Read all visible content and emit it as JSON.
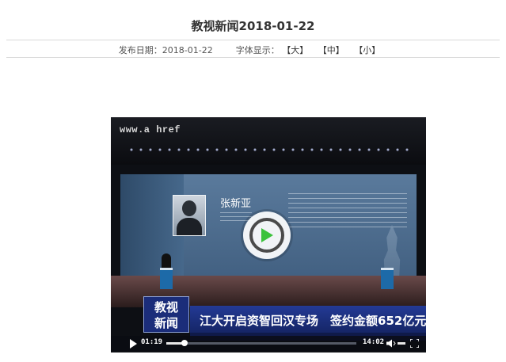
{
  "article": {
    "title": "教视新闻2018-01-22",
    "publish_label": "发布日期：",
    "publish_date": "2018-01-22",
    "font_label": "字体显示：",
    "font_large": "【大】",
    "font_medium": "【中】",
    "font_small": "【小】"
  },
  "video": {
    "watermark": "www.a href",
    "speaker_name": "张新亚",
    "logo_line1": "教视",
    "logo_line2": "新闻",
    "headline": "江大开启资智回汉专场　签约金额652亿元",
    "current_time": "01:19",
    "duration": "14:02",
    "progress_fraction": 0.094
  }
}
